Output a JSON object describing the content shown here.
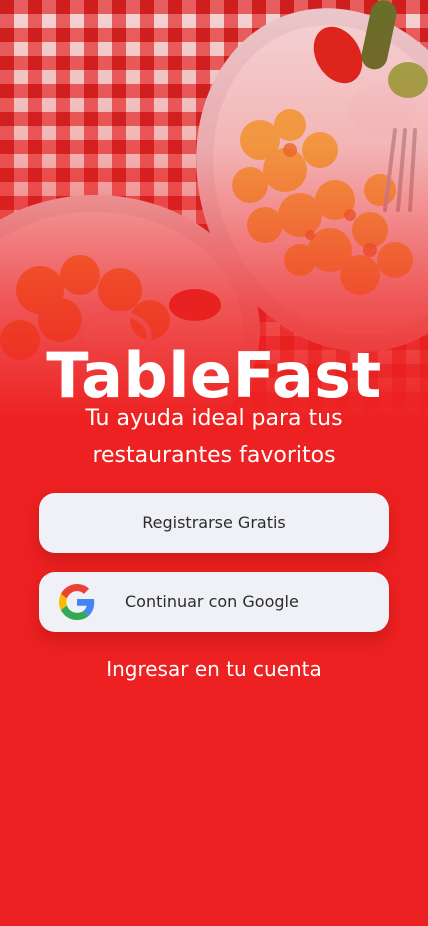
{
  "app": {
    "name": "TableFast",
    "tagline": "Tu ayuda ideal para tus restaurantes favoritos"
  },
  "actions": {
    "register_label": "Registrarse Gratis",
    "google_label": "Continuar con Google",
    "login_label": "Ingresar en tu cuenta"
  },
  "colors": {
    "brand_red": "#ed2121",
    "button_bg": "#eff1f6",
    "button_text": "#2c2c2c",
    "text_light": "#ffffff"
  },
  "icons": {
    "google": "google-g-icon"
  }
}
